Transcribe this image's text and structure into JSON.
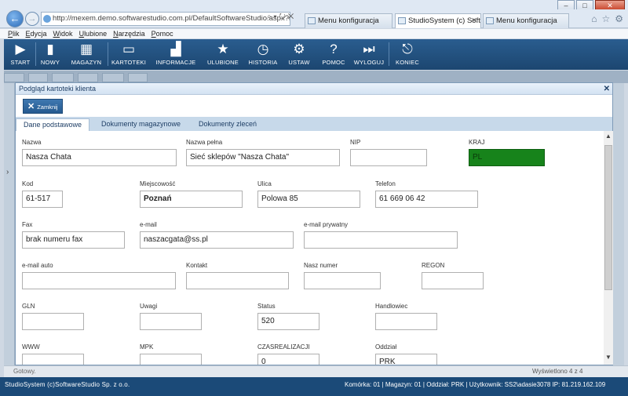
{
  "browser": {
    "address": "http://mexem.demo.softwarestudio.com.pl/DefaultSoftwareStudio.aspx?rola=MI",
    "tabs": [
      {
        "label": "Menu konfiguracja",
        "active": false
      },
      {
        "label": "StudioSystem (c) Soft...",
        "active": true
      },
      {
        "label": "Menu konfiguracja",
        "active": false
      }
    ],
    "menu": [
      "Plik",
      "Edycja",
      "Widok",
      "Ulubione",
      "Narzędzia",
      "Pomoc"
    ]
  },
  "toolbar": [
    {
      "label": "START",
      "icon": "play-icon"
    },
    {
      "label": "NOWY",
      "icon": "document-icon"
    },
    {
      "label": "MAGAZYN",
      "icon": "grid-icon"
    },
    {
      "label": "KARTOTEKI",
      "icon": "monitor-icon"
    },
    {
      "label": "INFORMACJE",
      "icon": "bar-chart-icon"
    },
    {
      "label": "ULUBIONE",
      "icon": "star-icon"
    },
    {
      "label": "HISTORIA",
      "icon": "clock-icon"
    },
    {
      "label": "USTAW",
      "icon": "gears-icon"
    },
    {
      "label": "POMOC",
      "icon": "help-icon"
    },
    {
      "label": "WYLOGUJ",
      "icon": "logout-icon"
    },
    {
      "label": "KONIEC",
      "icon": "exit-icon"
    }
  ],
  "dialog": {
    "title": "Podgląd kartoteki klienta",
    "close_label": "Zamknij",
    "tabs": [
      "Dane podstawowe",
      "Dokumenty magazynowe",
      "Dokumenty zleceń"
    ]
  },
  "fields": [
    {
      "label": "Nazwa",
      "value": "Nasza Chata",
      "bold": false
    },
    {
      "label": "Nazwa pełna",
      "value": "Sieć sklepów \"Nasza Chata\"",
      "bold": false
    },
    {
      "label": "NIP",
      "value": "",
      "bold": false
    },
    {
      "label": "KRAJ",
      "value": "PL",
      "bold": false,
      "bg": "#17831b"
    },
    {
      "label": "Kod",
      "value": "61-517",
      "bold": false
    },
    {
      "label": "Miejscowość",
      "value": "Poznań",
      "bold": true
    },
    {
      "label": "Ulica",
      "value": "Polowa 85",
      "bold": false
    },
    {
      "label": "Telefon",
      "value": "61 669 06 42",
      "bold": false
    },
    {
      "label": "Fax",
      "value": "brak numeru fax",
      "bold": false
    },
    {
      "label": "e-mail",
      "value": "naszacgata@ss.pl",
      "bold": false
    },
    {
      "label": "e-mail prywatny",
      "value": "",
      "bold": false
    },
    {
      "label": "e-mail auto",
      "value": "",
      "bold": false
    },
    {
      "label": "Kontakt",
      "value": "",
      "bold": false
    },
    {
      "label": "Nasz numer",
      "value": "",
      "bold": false
    },
    {
      "label": "REGON",
      "value": "",
      "bold": false
    },
    {
      "label": "GLN",
      "value": "",
      "bold": false
    },
    {
      "label": "Uwagi",
      "value": "",
      "bold": false
    },
    {
      "label": "Status",
      "value": "520",
      "bold": false
    },
    {
      "label": "Handlowiec",
      "value": "",
      "bold": false
    },
    {
      "label": "WWW",
      "value": "",
      "bold": false
    },
    {
      "label": "MPK",
      "value": "",
      "bold": false
    },
    {
      "label": "CZASREALIZACJI",
      "value": "0",
      "bold": false
    },
    {
      "label": "Oddział",
      "value": "PRK",
      "bold": false
    }
  ],
  "status": {
    "left": "Gotowy.",
    "paging": "Wyświetlono 4 z 4"
  },
  "footer": {
    "company": "StudioSystem (c)SoftwareStudio Sp. z o.o.",
    "info": "Komórka: 01 | Magazyn: 01 | Oddział: PRK | Użytkownik: SS2\\adasie3078 IP: 81.219.162.109"
  }
}
